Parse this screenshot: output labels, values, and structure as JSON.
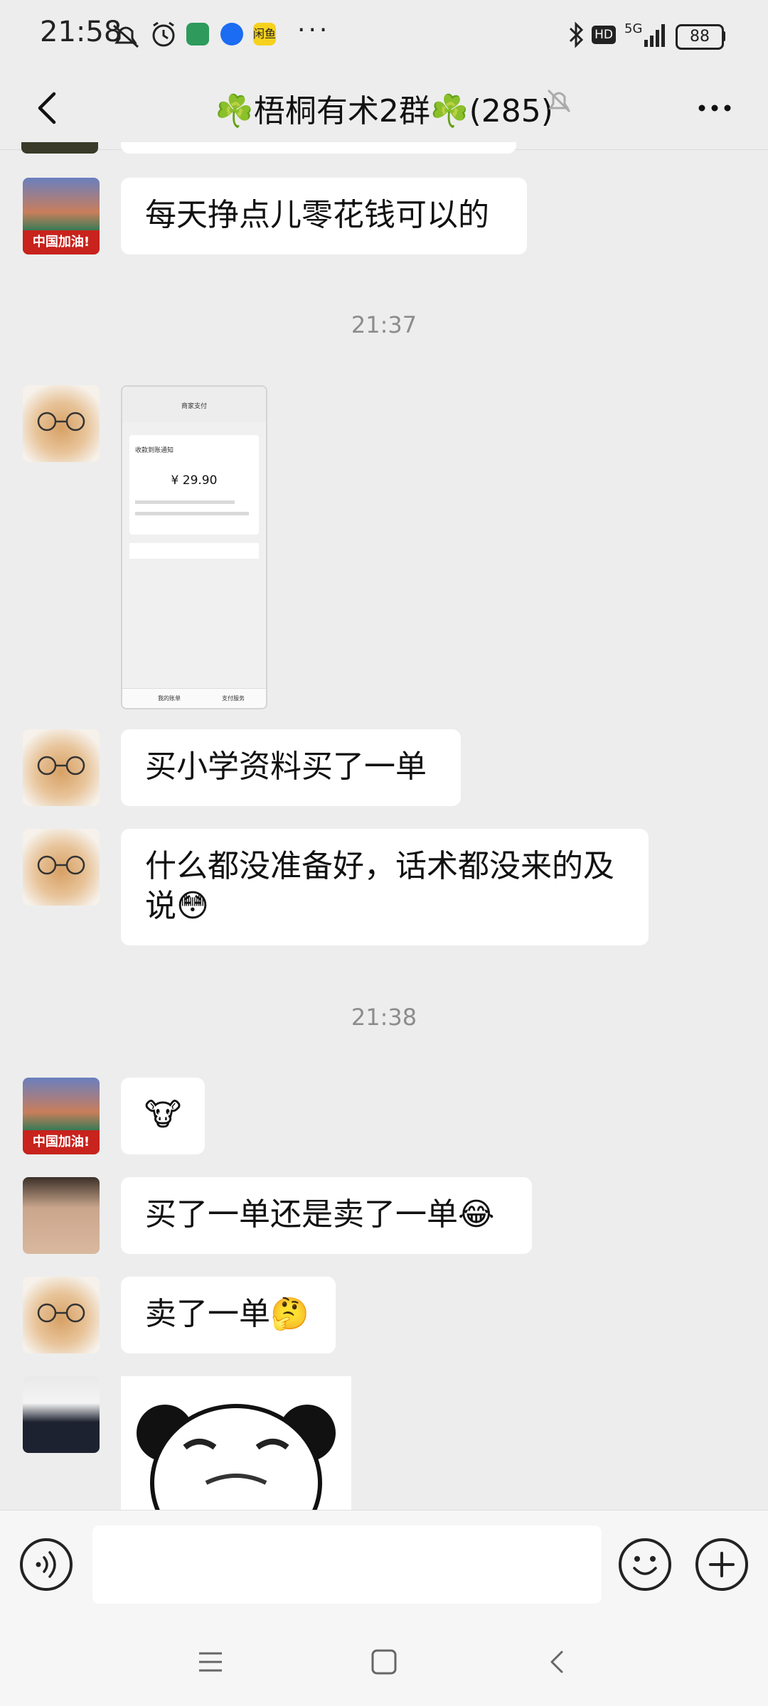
{
  "status_bar": {
    "time": "21:58",
    "battery": "88",
    "network": "5G",
    "hd": "HD",
    "app_label": "闲鱼"
  },
  "header": {
    "title": "☘️梧桐有术2群☘️(285)"
  },
  "messages": {
    "m1_text": "每天挣点儿零花钱可以的",
    "ts1": "21:37",
    "shot": {
      "title": "商家支付",
      "subtitle": "收款到账通知",
      "amount": "¥ 29.90",
      "footer_left": "我的账单",
      "footer_right": "支付服务"
    },
    "m3_text": "买小学资料买了一单",
    "m4_text": "什么都没准备好，话术都没来的及说😳",
    "ts2": "21:38",
    "m5_text": "🐮",
    "m6_text": "买了一单还是卖了一单😂",
    "m7_text": "卖了一单🤔"
  },
  "avatars": {
    "flag_text": "中国加油!"
  },
  "icons": {
    "back": "back-arrow-icon",
    "mute": "mute-bell-icon",
    "more": "more-dots-icon",
    "voice": "voice-icon",
    "emoji": "emoji-icon",
    "plus": "plus-icon",
    "nav_menu": "menu-icon",
    "nav_home": "home-icon",
    "nav_back": "nav-back-icon"
  }
}
